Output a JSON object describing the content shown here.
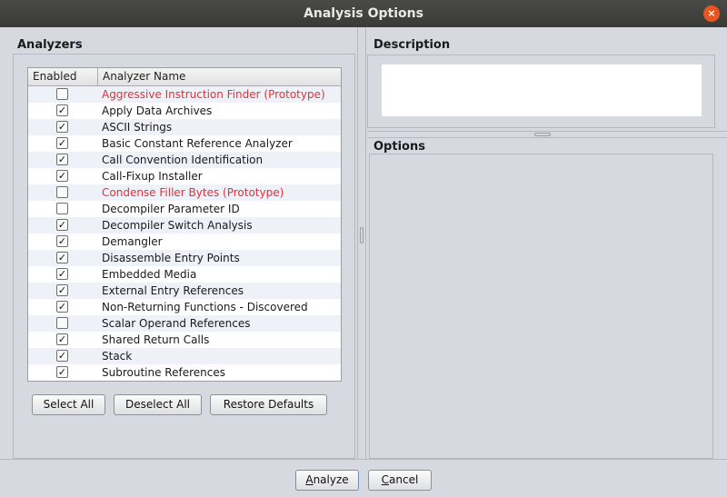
{
  "window": {
    "title": "Analysis Options",
    "close_glyph": "×"
  },
  "analyzers": {
    "heading": "Analyzers",
    "columns": {
      "enabled": "Enabled",
      "name": "Analyzer Name"
    },
    "rows": [
      {
        "name": "Aggressive Instruction Finder (Prototype)",
        "enabled": false,
        "prototype": true
      },
      {
        "name": "Apply Data Archives",
        "enabled": true,
        "prototype": false
      },
      {
        "name": "ASCII Strings",
        "enabled": true,
        "prototype": false
      },
      {
        "name": "Basic Constant Reference Analyzer",
        "enabled": true,
        "prototype": false
      },
      {
        "name": "Call Convention Identification",
        "enabled": true,
        "prototype": false
      },
      {
        "name": "Call-Fixup Installer",
        "enabled": true,
        "prototype": false
      },
      {
        "name": "Condense Filler Bytes (Prototype)",
        "enabled": false,
        "prototype": true
      },
      {
        "name": "Decompiler Parameter ID",
        "enabled": false,
        "prototype": false
      },
      {
        "name": "Decompiler Switch Analysis",
        "enabled": true,
        "prototype": false
      },
      {
        "name": "Demangler",
        "enabled": true,
        "prototype": false
      },
      {
        "name": "Disassemble Entry Points",
        "enabled": true,
        "prototype": false
      },
      {
        "name": "Embedded Media",
        "enabled": true,
        "prototype": false
      },
      {
        "name": "External Entry References",
        "enabled": true,
        "prototype": false
      },
      {
        "name": "Non-Returning Functions - Discovered",
        "enabled": true,
        "prototype": false
      },
      {
        "name": "Scalar Operand References",
        "enabled": false,
        "prototype": false
      },
      {
        "name": "Shared Return Calls",
        "enabled": true,
        "prototype": false
      },
      {
        "name": "Stack",
        "enabled": true,
        "prototype": false
      },
      {
        "name": "Subroutine References",
        "enabled": true,
        "prototype": false
      }
    ],
    "check_glyph": "✓",
    "buttons": {
      "select_all": "Select All",
      "deselect_all": "Deselect All",
      "restore_defaults": "Restore Defaults"
    }
  },
  "description": {
    "heading": "Description",
    "text": ""
  },
  "options": {
    "heading": "Options"
  },
  "footer": {
    "analyze": "Analyze",
    "cancel": "Cancel"
  },
  "colors": {
    "prototype_text": "#e0323a",
    "titlebar": "#3c3c3a",
    "close_button": "#e95420"
  }
}
